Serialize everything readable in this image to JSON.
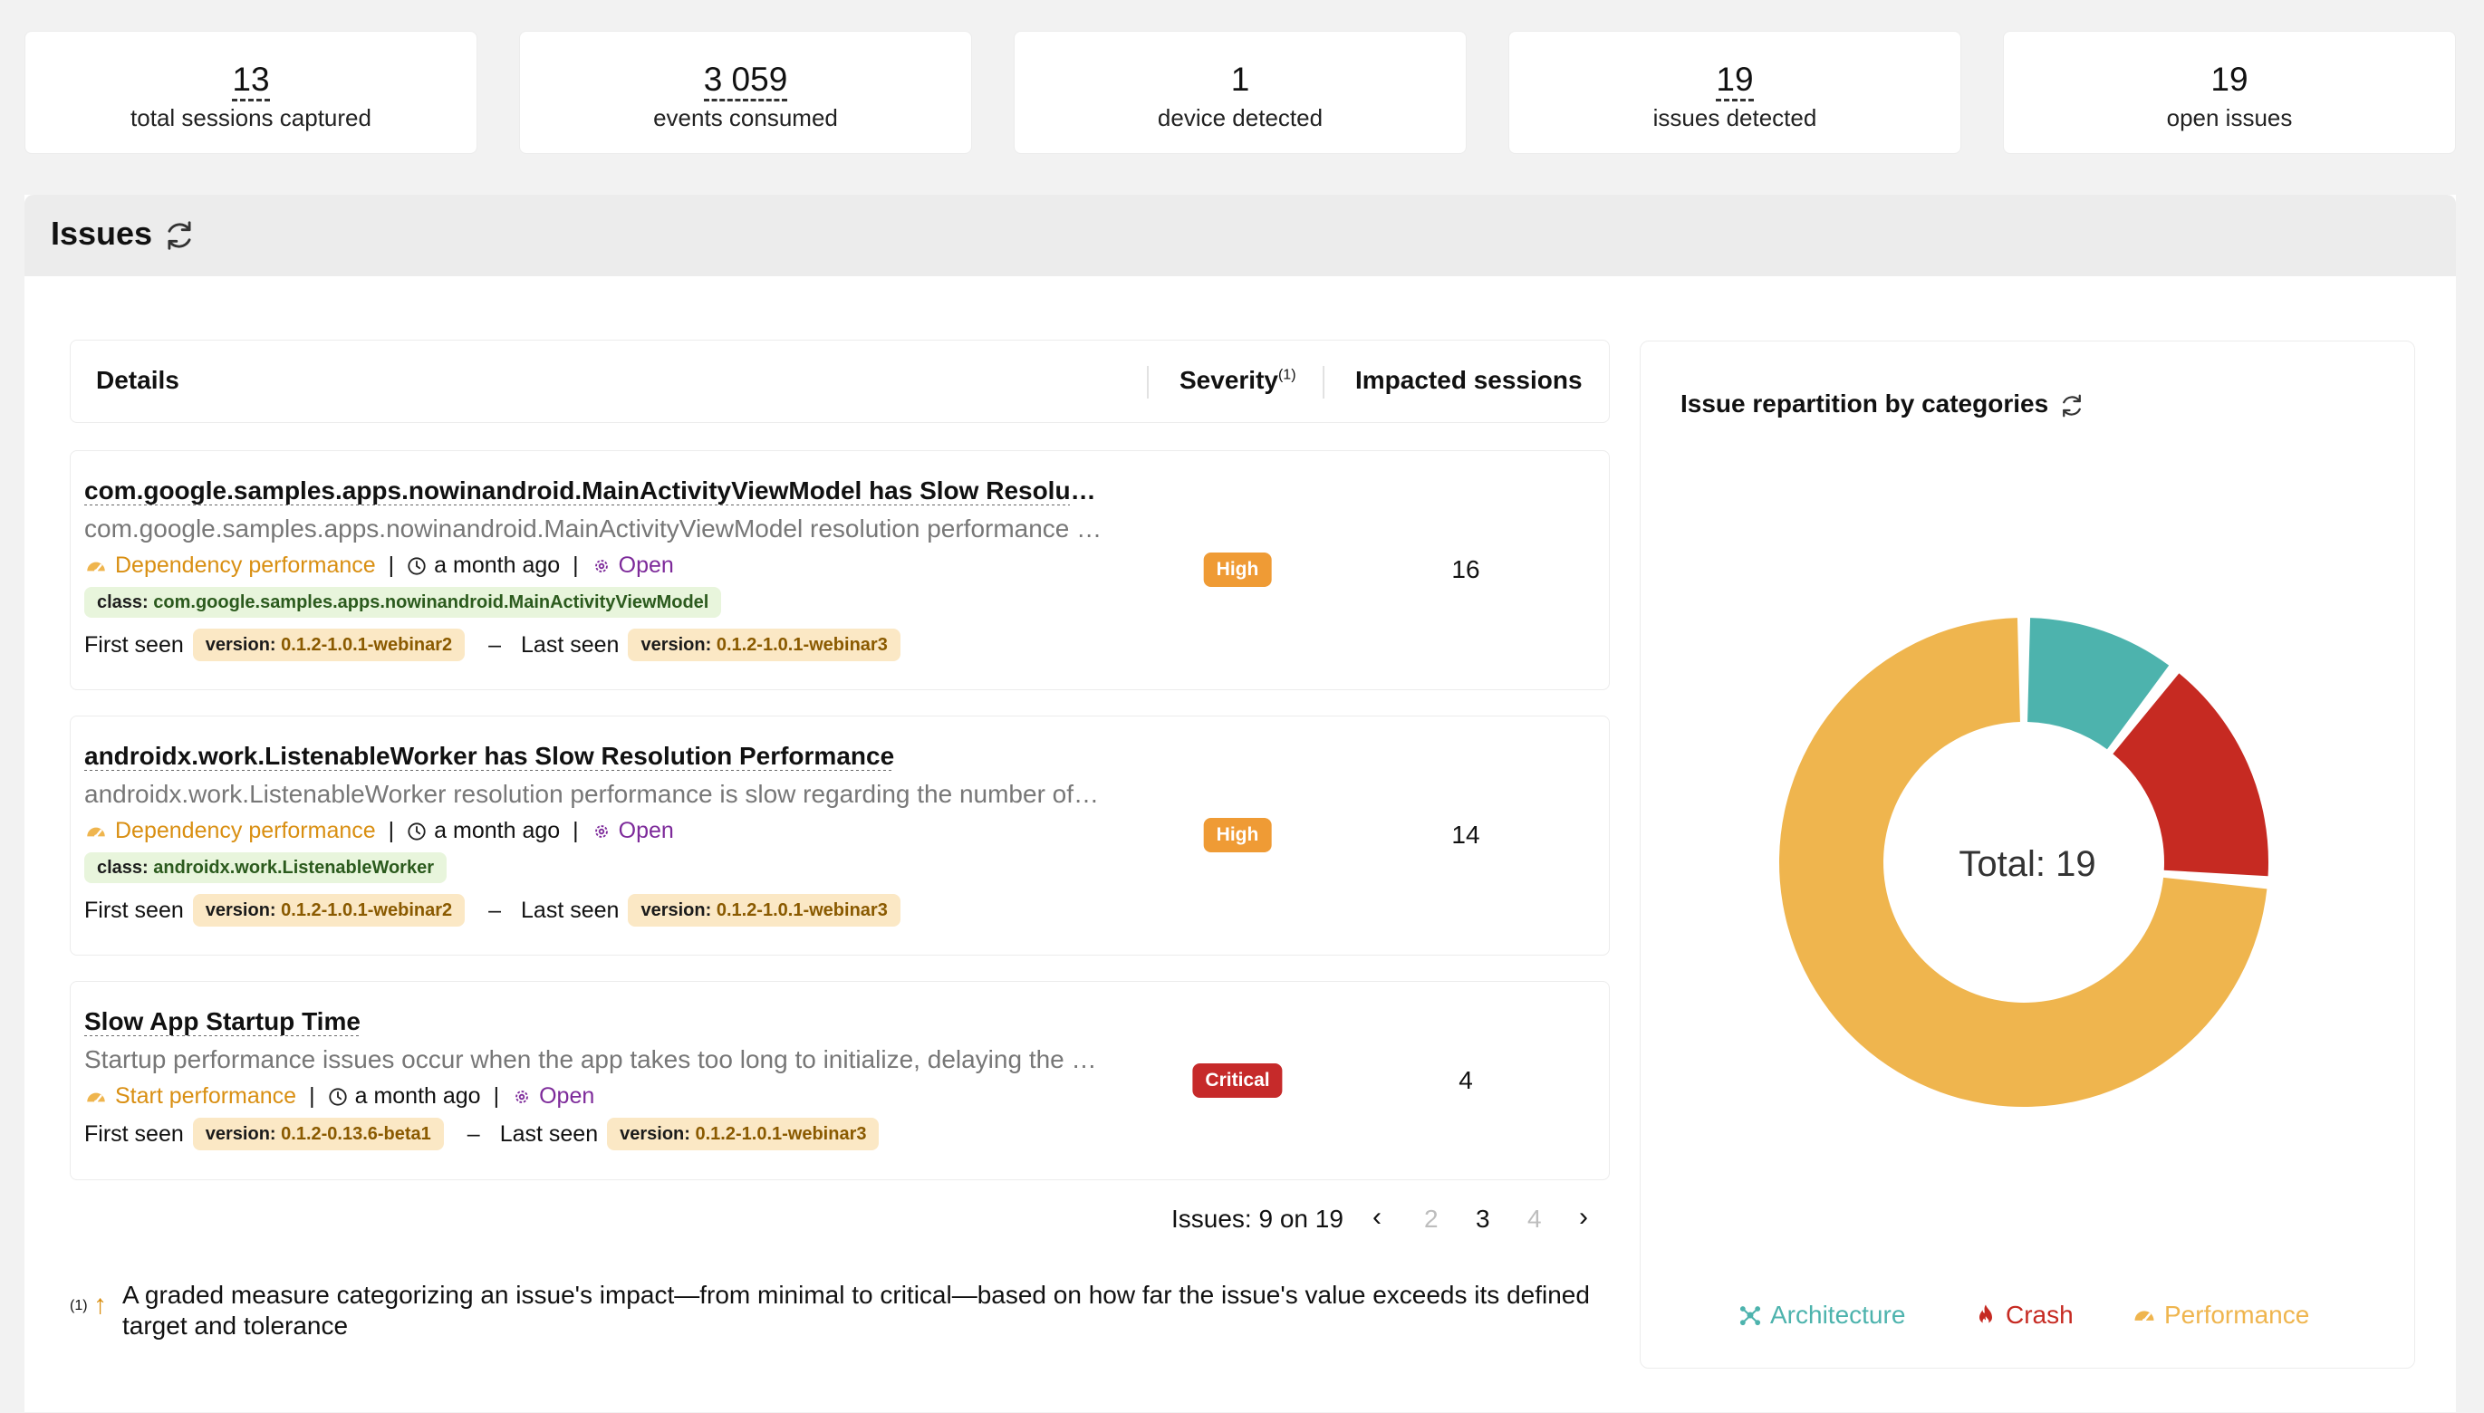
{
  "stats": [
    {
      "value": "13",
      "label": "total sessions captured",
      "link": true
    },
    {
      "value": "3 059",
      "label": "events consumed",
      "link": true
    },
    {
      "value": "1",
      "label": "device detected",
      "link": false
    },
    {
      "value": "19",
      "label": "issues detected",
      "link": true
    },
    {
      "value": "19",
      "label": "open issues",
      "link": false
    }
  ],
  "panel": {
    "title": "Issues"
  },
  "table": {
    "headers": {
      "details": "Details",
      "severity": "Severity",
      "severity_sup": "(1)",
      "impacted": "Impacted sessions"
    },
    "first_seen_label": "First seen",
    "last_seen_label": "Last seen",
    "version_key": "version:",
    "class_key": "class:",
    "dash": "–",
    "separator": "|",
    "rows": [
      {
        "title": "com.google.samples.apps.nowinandroid.MainActivityViewModel has Slow Resolution Performance",
        "description": "com.google.samples.apps.nowinandroid.MainActivityViewModel resolution performance is slow regarding the number of dependencies",
        "category": "Dependency performance",
        "time": "a month ago",
        "status": "Open",
        "class_value": "com.google.samples.apps.nowinandroid.MainActivityViewModel",
        "first_version": "0.1.2-1.0.1-webinar2",
        "last_version": "0.1.2-1.0.1-webinar3",
        "severity": "High",
        "impacted": "16"
      },
      {
        "title": "androidx.work.ListenableWorker has Slow Resolution Performance",
        "description": "androidx.work.ListenableWorker resolution performance is slow regarding the number of dependencies",
        "category": "Dependency performance",
        "time": "a month ago",
        "status": "Open",
        "class_value": "androidx.work.ListenableWorker",
        "first_version": "0.1.2-1.0.1-webinar2",
        "last_version": "0.1.2-1.0.1-webinar3",
        "severity": "High",
        "impacted": "14"
      },
      {
        "title": "Slow App Startup Time",
        "description": "Startup performance issues occur when the app takes too long to initialize, delaying the first frame",
        "category": "Start performance",
        "time": "a month ago",
        "status": "Open",
        "first_version": "0.1.2-0.13.6-beta1",
        "last_version": "0.1.2-1.0.1-webinar3",
        "severity": "Critical",
        "impacted": "4"
      }
    ]
  },
  "pagination": {
    "summary": "Issues: 9 on 19",
    "pages": [
      "2",
      "3",
      "4"
    ],
    "current": "3",
    "prev": "‹",
    "next": "›"
  },
  "footnote": {
    "mark": "(1)",
    "text": "A graded measure categorizing an issue's impact—from minimal to critical—based on how far the issue's value exceeds its defined target and tolerance"
  },
  "chart_data": {
    "type": "pie",
    "title": "Issue repartition by categories",
    "center_label": "Total: 19",
    "categories": [
      "Architecture",
      "Crash",
      "Performance"
    ],
    "values": [
      2,
      3,
      14
    ],
    "colors": [
      "#4db3ad",
      "#c62a22",
      "#efb54e"
    ]
  },
  "icons": {
    "refresh": "refresh-icon",
    "performance": "gauge-icon",
    "clock": "clock-icon",
    "status": "gear-icon",
    "architecture": "network-icon",
    "crash": "flame-icon"
  }
}
